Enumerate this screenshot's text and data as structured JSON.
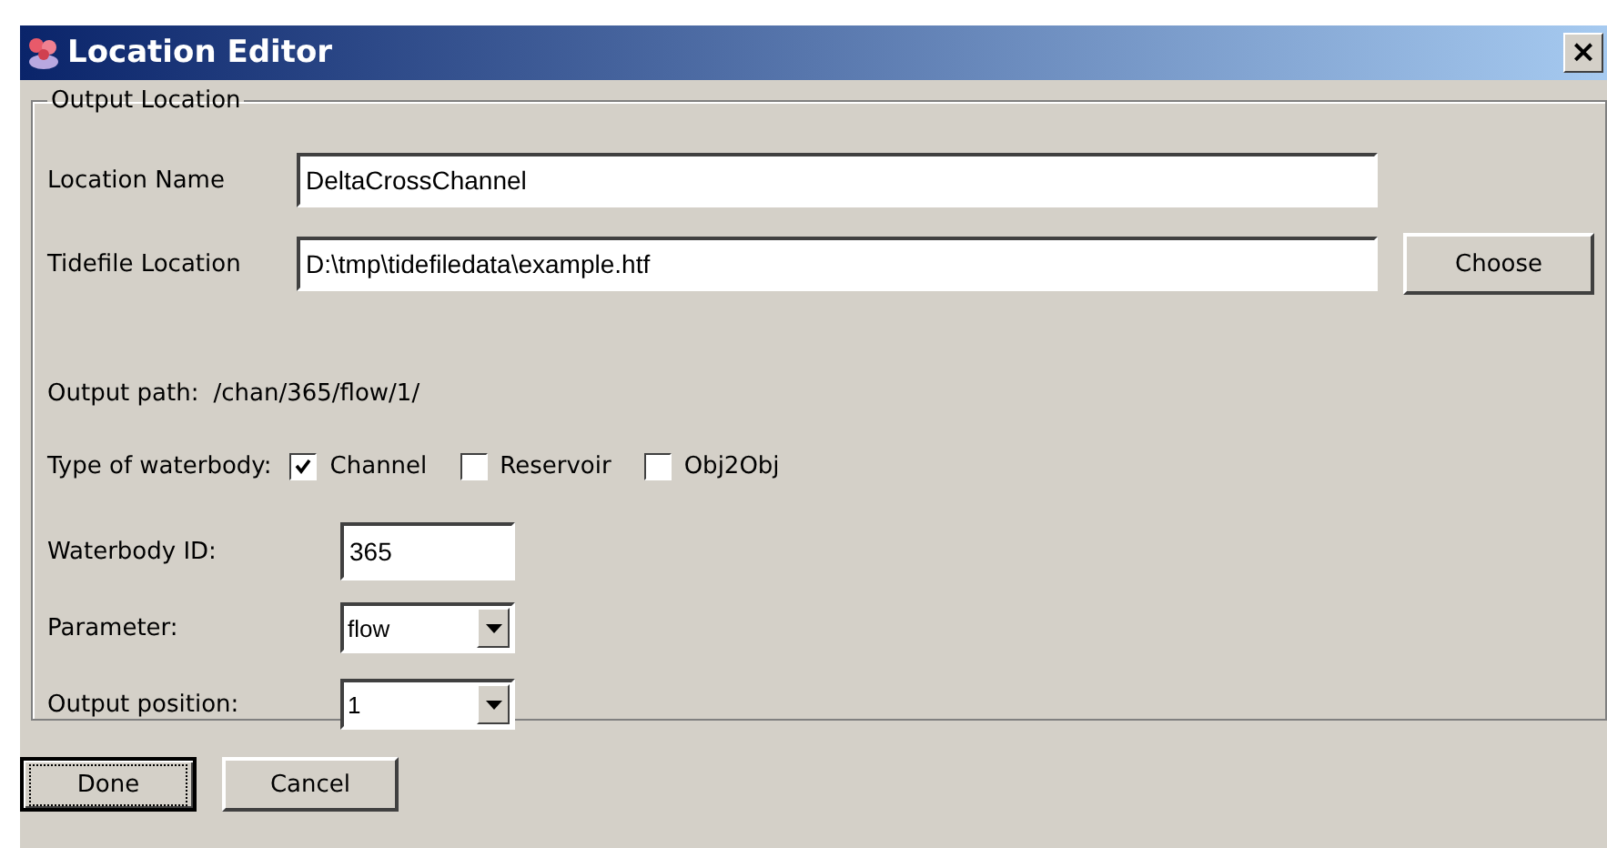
{
  "window": {
    "title": "Location Editor",
    "close": "×"
  },
  "group": {
    "title": "Output Location",
    "fields": [
      {
        "label": "Location Name",
        "value": "DeltaCrossChannel"
      },
      {
        "label": "Tidefile Location",
        "value": "D:\\tmp\\tidefiledata\\example.htf",
        "button": "Choose"
      }
    ],
    "output_path": {
      "label": "Output path:",
      "value": "/chan/365/flow/1/"
    },
    "waterbody_type": {
      "label": "Type of waterbody:",
      "options": [
        {
          "label": "Channel",
          "checked": true
        },
        {
          "label": "Reservoir",
          "checked": false
        },
        {
          "label": "Obj2Obj",
          "checked": false
        }
      ]
    },
    "inputs": [
      {
        "kind": "text",
        "label": "Waterbody ID:",
        "value": "365"
      },
      {
        "kind": "combo",
        "label": "Parameter:",
        "value": "flow"
      },
      {
        "kind": "combo",
        "label": "Output position:",
        "value": "1"
      }
    ]
  },
  "buttons": [
    {
      "label": "Done",
      "focused": true
    },
    {
      "label": "Cancel",
      "focused": false
    }
  ]
}
